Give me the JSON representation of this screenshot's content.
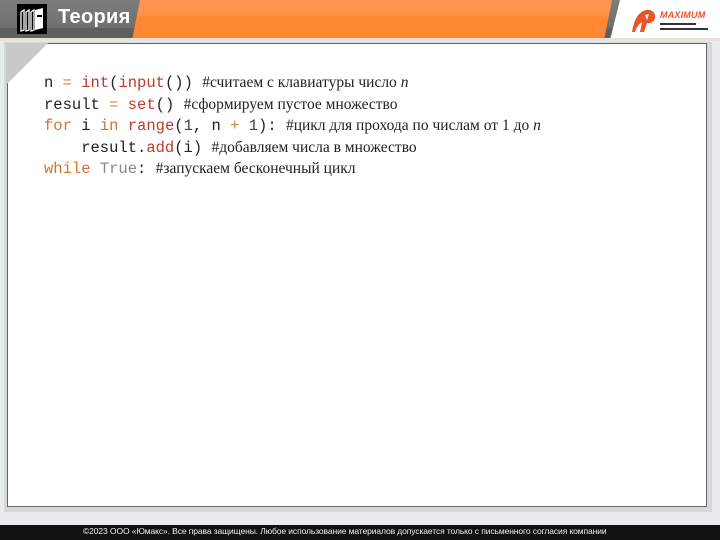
{
  "header": {
    "title": "Теория",
    "logo_text": "MAXIMUM",
    "book_icon": "books-icon",
    "logo_icon": "maximum-logo-icon"
  },
  "colors": {
    "accent_orange": "#ff8a33",
    "header_gray": "#6a6a6a",
    "keyword": "#d47333",
    "function": "#c0392b"
  },
  "code": {
    "lines": [
      {
        "tokens": [
          {
            "t": "n ",
            "c": "plain"
          },
          {
            "t": "=",
            "c": "op"
          },
          {
            "t": " ",
            "c": "plain"
          },
          {
            "t": "int",
            "c": "fn"
          },
          {
            "t": "(",
            "c": "plain"
          },
          {
            "t": "input",
            "c": "fn"
          },
          {
            "t": "()) ",
            "c": "plain"
          }
        ],
        "comment": "#считаем с клавиатуры число ",
        "comment_italic": "n"
      },
      {
        "tokens": [
          {
            "t": "result ",
            "c": "plain"
          },
          {
            "t": "=",
            "c": "op"
          },
          {
            "t": " ",
            "c": "plain"
          },
          {
            "t": "set",
            "c": "fn"
          },
          {
            "t": "() ",
            "c": "plain"
          }
        ],
        "comment": "#сформируем пустое множество",
        "comment_italic": ""
      },
      {
        "tokens": [
          {
            "t": "for",
            "c": "kw"
          },
          {
            "t": " i ",
            "c": "plain"
          },
          {
            "t": "in",
            "c": "kw"
          },
          {
            "t": " ",
            "c": "plain"
          },
          {
            "t": "range",
            "c": "fn"
          },
          {
            "t": "(",
            "c": "plain"
          },
          {
            "t": "1",
            "c": "num"
          },
          {
            "t": ", n ",
            "c": "plain"
          },
          {
            "t": "+",
            "c": "op"
          },
          {
            "t": " ",
            "c": "plain"
          },
          {
            "t": "1",
            "c": "num"
          },
          {
            "t": "): ",
            "c": "plain"
          }
        ],
        "comment": "#цикл для прохода по числам от 1 до ",
        "comment_italic": "n"
      },
      {
        "tokens": [
          {
            "t": "    result.",
            "c": "plain"
          },
          {
            "t": "add",
            "c": "fn"
          },
          {
            "t": "(i) ",
            "c": "plain"
          }
        ],
        "comment": "#добавляем числа в множество",
        "comment_italic": ""
      },
      {
        "tokens": [
          {
            "t": "while",
            "c": "kw"
          },
          {
            "t": " ",
            "c": "plain"
          },
          {
            "t": "True",
            "c": "tru"
          },
          {
            "t": ": ",
            "c": "plain"
          }
        ],
        "comment": "#запускаем бесконечный цикл",
        "comment_italic": ""
      }
    ]
  },
  "footer": {
    "copyright": "©2023 ООО «Юмакс». Все права защищены. Любое использование материалов допускается только с  письменного согласия компании"
  }
}
